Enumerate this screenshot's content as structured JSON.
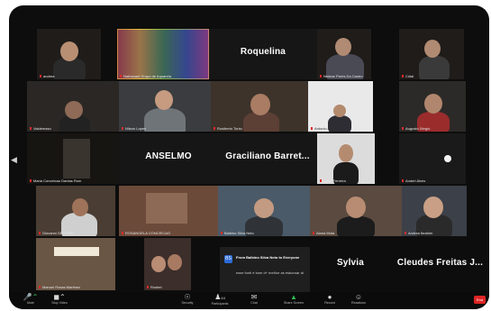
{
  "tiles": [
    {
      "label": "andrea",
      "big": ""
    },
    {
      "label": "Nathanael Grupo de Aquarela",
      "big": ""
    },
    {
      "label": "",
      "big": "Roquelina"
    },
    {
      "label": "Nelmar Parris Da Castro",
      "big": ""
    },
    {
      "label": "Cidal",
      "big": ""
    },
    {
      "label": "Valdemaso",
      "big": ""
    },
    {
      "label": "Nilson Lopes",
      "big": ""
    },
    {
      "label": "Rosiberto Tonio",
      "big": ""
    },
    {
      "label": "Antonio Araujo",
      "big": ""
    },
    {
      "label": "Augusto Sérgio",
      "big": ""
    },
    {
      "label": "Maria Conceicao Dantas Rom",
      "big": ""
    },
    {
      "label": "",
      "big": "ANSELMO"
    },
    {
      "label": "",
      "big": "Graciliano Barret..."
    },
    {
      "label": "Carla Ferreira",
      "big": ""
    },
    {
      "label": "Anderi Alves",
      "big": ""
    },
    {
      "label": "Giovanni GRTTERL",
      "big": ""
    },
    {
      "label": "ROSANGELA CONCEICAO",
      "big": ""
    },
    {
      "label": "Balbino Silva Neto",
      "big": ""
    },
    {
      "label": "Alana Mota",
      "big": ""
    },
    {
      "label": "Andrea Ibrahim",
      "big": ""
    },
    {
      "label": "Manuel Rosas Martinez",
      "big": ""
    },
    {
      "label": "Rosbel",
      "big": ""
    },
    {
      "label": "",
      "big": "Sylvia"
    },
    {
      "label": "",
      "big": "Cleudes Freitas J..."
    }
  ],
  "chat": {
    "from": "From Balbino Silva Neto to Everyone",
    "message": "esse fonti é bom d+ melhor as esboroar al",
    "avatar": "BS"
  },
  "toolbar": [
    {
      "icon": "microphone-icon",
      "label": "Mute"
    },
    {
      "icon": "video-icon",
      "label": "Stop Video"
    },
    {
      "icon": "shield-icon",
      "label": "Security"
    },
    {
      "icon": "participants-icon",
      "label": "Participants",
      "count": "44"
    },
    {
      "icon": "chat-icon",
      "label": "Chat"
    },
    {
      "icon": "share-screen-icon",
      "label": "Share Screen"
    },
    {
      "icon": "record-icon",
      "label": "Record"
    },
    {
      "icon": "reactions-icon",
      "label": "Reactions"
    }
  ],
  "end_label": "End",
  "colors": {
    "mic_muted": "#e02a2a",
    "active_speaker": "#e5d24a",
    "end": "#e02424",
    "share": "#2fb84f"
  }
}
